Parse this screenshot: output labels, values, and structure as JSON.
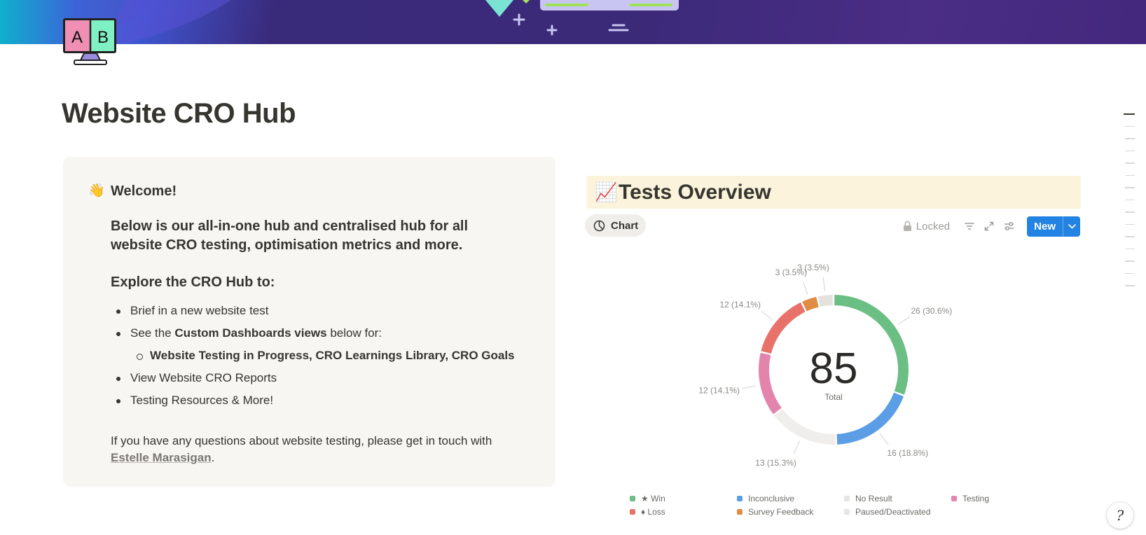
{
  "page": {
    "title": "Website CRO Hub",
    "icon_letters": [
      "A",
      "B"
    ]
  },
  "callout": {
    "emoji": "👋",
    "heading": "Welcome!",
    "intro": "Below is our all-in-one hub and centralised hub for all website CRO testing, optimisation metrics and more.",
    "explore_heading": "Explore the CRO Hub to:",
    "bullets": {
      "b1": "Brief in a new website test",
      "b2_prefix": "See the ",
      "b2_bold": "Custom Dashboards views",
      "b2_suffix": " below for:",
      "b2_sub": "Website Testing in Progress, CRO Learnings Library, CRO Goals",
      "b3": "View Website CRO Reports",
      "b4": "Testing Resources & More!"
    },
    "contact_prefix": "If you have any questions about website testing, please get in touch with ",
    "contact_link": "Estelle Marasigan",
    "contact_suffix": "."
  },
  "tests_overview": {
    "emoji": "📈",
    "title": "Tests Overview",
    "view_tab": "Chart",
    "locked_label": "Locked",
    "new_button": "New"
  },
  "icons": {
    "view_tab": "pie-chart-icon",
    "locked": "lock-icon",
    "filter": "filter-icon",
    "expand": "expand-icon",
    "settings": "sliders-icon",
    "new_dropdown": "chevron-down-icon",
    "help": "help-icon"
  },
  "chart_data": {
    "type": "pie",
    "donut": true,
    "center_value": "85",
    "center_label": "Total",
    "total": 85,
    "slices": [
      {
        "name": "★ Win",
        "value": 26,
        "label": "26 (30.6%)",
        "color": "#6cbf84"
      },
      {
        "name": "Inconclusive",
        "value": 16,
        "label": "16 (18.8%)",
        "color": "#5b9ee6"
      },
      {
        "name": "No Result",
        "value": 13,
        "label": "13 (15.3%)",
        "color": "#efeeec"
      },
      {
        "name": "Testing",
        "value": 12,
        "label": "12 (14.1%)",
        "color": "#e384ad"
      },
      {
        "name": "♦ Loss",
        "value": 12,
        "label": "12 (14.1%)",
        "color": "#e8726a"
      },
      {
        "name": "Survey Feedback",
        "value": 3,
        "label": "3 (3.5%)",
        "color": "#e08c44"
      },
      {
        "name": "Paused/Deactivated",
        "value": 3,
        "label": "3 (3.5%)",
        "color": "#e3e2df"
      }
    ],
    "legend": [
      {
        "name": "★ Win",
        "color": "#6cbf84"
      },
      {
        "name": "Inconclusive",
        "color": "#5b9ee6"
      },
      {
        "name": "No Result",
        "color": "#efeeec"
      },
      {
        "name": "Testing",
        "color": "#e384ad"
      },
      {
        "name": "♦ Loss",
        "color": "#e8726a"
      },
      {
        "name": "Survey Feedback",
        "color": "#e08c44"
      },
      {
        "name": "Paused/Deactivated",
        "color": "#e3e2df"
      }
    ],
    "legend_placement": "bottom"
  },
  "help": {
    "glyph": "?"
  }
}
